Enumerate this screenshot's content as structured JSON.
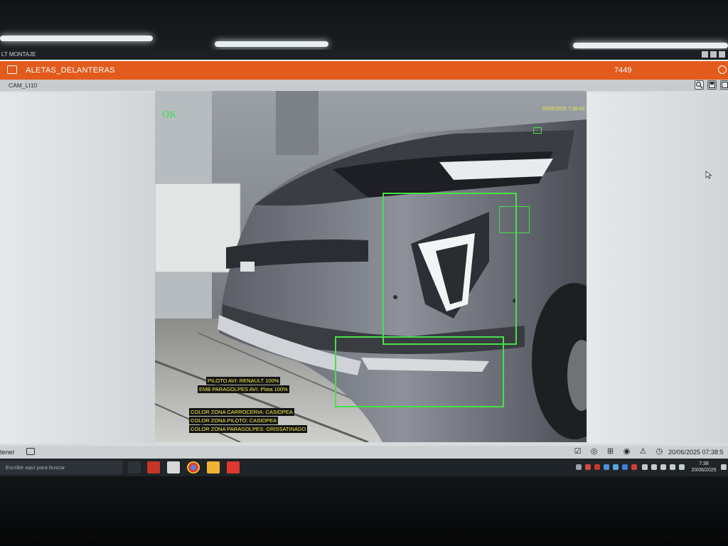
{
  "window": {
    "title": "LT MONTAJE"
  },
  "app": {
    "title": "ALETAS_DELANTERAS",
    "counter": "7449",
    "accent": "#e25a1c"
  },
  "camera": {
    "label": "CAM_LI10"
  },
  "toolbar": {
    "icons": [
      "zoom-icon",
      "save-icon",
      "fit-icon"
    ]
  },
  "inspection": {
    "result": "OK",
    "timestamp": "20/06/2025 7:38:43",
    "result_color": "#34e04a",
    "box_color": "#48e048",
    "labels": [
      "PILOTO AVI: RENAULT 100%",
      "EMB PARAGOLPES AVI: Plata 100%",
      "COLOR ZONA CARROCERIA: CASIOPEA",
      "COLOR ZONA PILOTO: CASIOPEA",
      "COLOR ZONA PARAGOLPES: GRISSATINADO"
    ]
  },
  "statusbar": {
    "left_text": "tener",
    "datetime": "20/06/2025 07:38:5"
  },
  "taskbar": {
    "search_placeholder": "Escribe aquí para buscar",
    "clock_time": "7:38",
    "clock_date": "20/06/2025"
  }
}
